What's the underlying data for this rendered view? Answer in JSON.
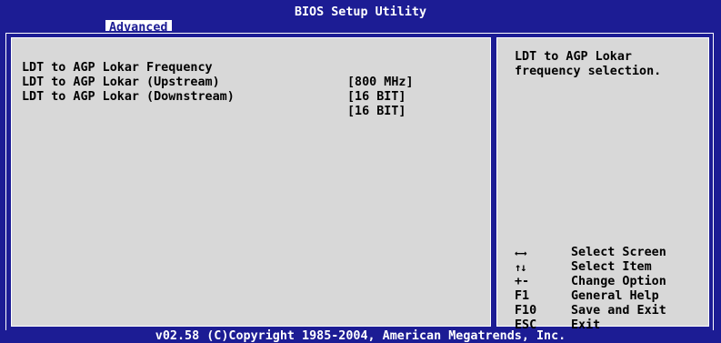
{
  "header": {
    "title": "BIOS Setup Utility",
    "active_tab": "Advanced"
  },
  "settings": [
    {
      "name": "LDT to AGP Lokar Frequency",
      "value": "[800 MHz]"
    },
    {
      "name": "LDT to AGP Lokar (Upstream)",
      "value": "[16 BIT]"
    },
    {
      "name": "LDT to AGP Lokar (Downstream)",
      "value": "[16 BIT]"
    }
  ],
  "help": {
    "text": "LDT to AGP Lokar frequency selection."
  },
  "keys": [
    {
      "icon": "left-right-arrows-icon",
      "key": "←→",
      "desc": "Select Screen"
    },
    {
      "icon": "up-down-arrows-icon",
      "key": "↑↓",
      "desc": "Select Item"
    },
    {
      "key": "+-",
      "desc": "Change Option"
    },
    {
      "key": "F1",
      "desc": "General Help"
    },
    {
      "key": "F10",
      "desc": "Save and Exit"
    },
    {
      "key": "ESC",
      "desc": "Exit"
    }
  ],
  "footer": {
    "copyright": "v02.58 (C)Copyright 1985-2004, American Megatrends, Inc."
  },
  "colors": {
    "background": "#1c1c94",
    "panel": "#d8d8d8",
    "text": "#000000",
    "header_text": "#ffffff"
  }
}
